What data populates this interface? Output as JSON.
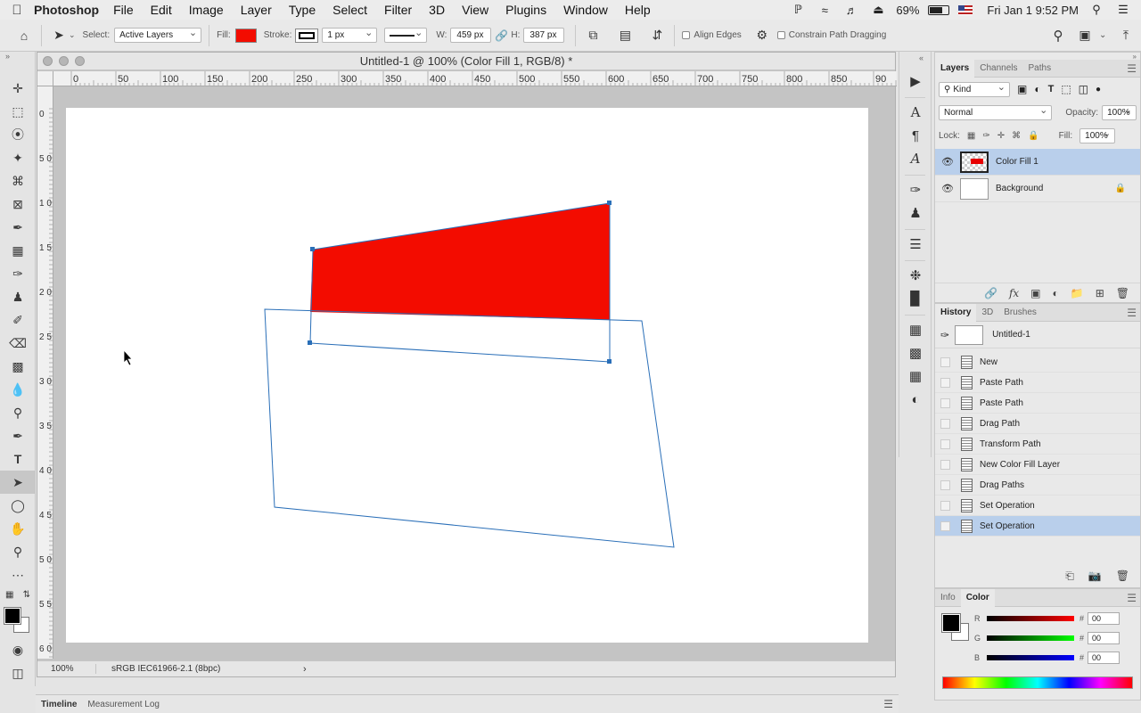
{
  "menubar": {
    "app": "Photoshop",
    "items": [
      "File",
      "Edit",
      "Image",
      "Layer",
      "Type",
      "Select",
      "Filter",
      "3D",
      "View",
      "Plugins",
      "Window",
      "Help"
    ],
    "battery": "69%",
    "clock": "Fri Jan 1  9:52 PM"
  },
  "options": {
    "select_label": "Select:",
    "select_value": "Active Layers",
    "fill_label": "Fill:",
    "stroke_label": "Stroke:",
    "stroke_width": "1 px",
    "w_label": "W:",
    "w_value": "459 px",
    "h_label": "H:",
    "h_value": "387 px",
    "align_edges": "Align Edges",
    "constrain": "Constrain Path Dragging",
    "fill_color": "#f30c00"
  },
  "document": {
    "title": "Untitled-1 @ 100% (Color Fill 1, RGB/8) *",
    "zoom": "100%",
    "profile": "sRGB IEC61966-2.1 (8bpc)",
    "hruler_labels": [
      "0",
      "50",
      "100",
      "150",
      "200",
      "250",
      "300",
      "350",
      "400",
      "450",
      "500",
      "550",
      "600",
      "650",
      "700",
      "750",
      "800",
      "850",
      "90"
    ],
    "vruler_labels": [
      "0",
      "5 0",
      "1 0 0",
      "1 5 0",
      "2 0 0",
      "2 5 0",
      "3 0 0",
      "3 5 0",
      "4 0 0",
      "4 5 0",
      "5 0 0",
      "5 5 0",
      "6 0"
    ]
  },
  "bottom_tabs": [
    "Timeline",
    "Measurement Log"
  ],
  "layers_panel": {
    "tabs": [
      "Layers",
      "Channels",
      "Paths"
    ],
    "kind": "Kind",
    "blend": "Normal",
    "opacity_label": "Opacity:",
    "opacity": "100%",
    "lock_label": "Lock:",
    "fill_label": "Fill:",
    "fill": "100%",
    "layers": [
      {
        "name": "Color Fill 1"
      },
      {
        "name": "Background"
      }
    ]
  },
  "history_panel": {
    "tabs": [
      "History",
      "3D",
      "Brushes"
    ],
    "snapshot": "Untitled-1",
    "items": [
      "New",
      "Paste Path",
      "Paste Path",
      "Drag Path",
      "Transform Path",
      "New Color Fill Layer",
      "Drag Paths",
      "Set Operation",
      "Set Operation"
    ]
  },
  "color_panel": {
    "tabs": [
      "Info",
      "Color"
    ],
    "channels": [
      {
        "label": "R",
        "value": "00"
      },
      {
        "label": "G",
        "value": "00"
      },
      {
        "label": "B",
        "value": "00"
      }
    ],
    "hash": "#"
  }
}
